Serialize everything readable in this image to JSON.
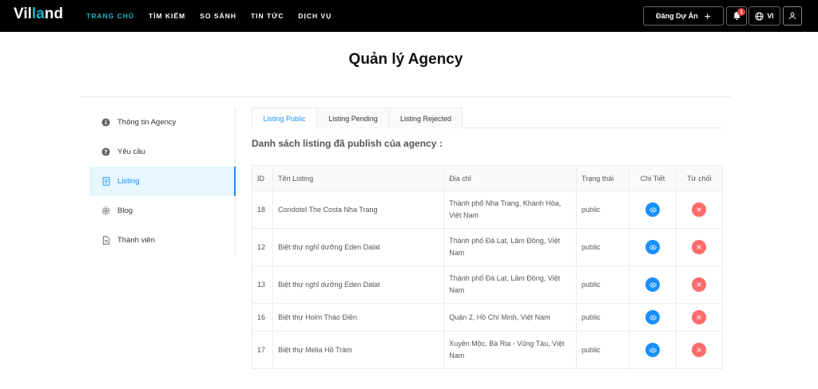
{
  "header": {
    "logo_prefix": "Vil",
    "logo_highlight": "la",
    "logo_suffix": "nd",
    "nav": [
      {
        "label": "TRANG CHỦ",
        "active": true
      },
      {
        "label": "TÌM KIẾM",
        "active": false
      },
      {
        "label": "SO SÁNH",
        "active": false
      },
      {
        "label": "TIN TỨC",
        "active": false
      },
      {
        "label": "DỊCH VỤ",
        "active": false
      }
    ],
    "post_label": "Đăng Dự Án",
    "notification_count": "1",
    "language": "Vi"
  },
  "page": {
    "title": "Quản lý Agency"
  },
  "sidebar": {
    "items": [
      {
        "label": "Thông tin Agency",
        "icon": "info-icon"
      },
      {
        "label": "Yêu cầu",
        "icon": "question-icon"
      },
      {
        "label": "Listing",
        "icon": "document-icon"
      },
      {
        "label": "Blog",
        "icon": "gear-icon"
      },
      {
        "label": "Thành viên",
        "icon": "file-icon"
      }
    ]
  },
  "tabs": [
    {
      "label": "Listing Public"
    },
    {
      "label": "Listing Pending"
    },
    {
      "label": "Listing Rejected"
    }
  ],
  "section_title": "Danh sách listing đã publish của agency :",
  "table": {
    "headers": {
      "id": "ID",
      "name": "Tên Listing",
      "address": "Địa chỉ",
      "status": "Trạng thái",
      "detail": "Chi Tiết",
      "reject": "Từ chối"
    },
    "rows": [
      {
        "id": "18",
        "name": "Condotel The Costa Nha Trang",
        "address": "Thành phố Nha Trang, Khánh Hòa, Việt Nam",
        "status": "public"
      },
      {
        "id": "12",
        "name": "Biệt thự nghỉ dưỡng Eden Dalat",
        "address": "Thành phố Đà Lạt, Lâm Đồng, Việt Nam",
        "status": "public"
      },
      {
        "id": "13",
        "name": "Biệt thự nghỉ dưỡng Eden Dalat",
        "address": "Thành phố Đà Lạt, Lâm Đồng, Việt Nam",
        "status": "public"
      },
      {
        "id": "16",
        "name": "Biệt thự Holm Tháo Điền",
        "address": "Quận 2, Hồ Chí Minh, Việt Nam",
        "status": "public"
      },
      {
        "id": "17",
        "name": "Biệt thự Melia Hồ Tràm",
        "address": "Xuyên Mộc, Bà Rịa - Vũng Tàu, Việt Nam",
        "status": "public"
      }
    ]
  },
  "colors": {
    "accent": "#1fb6c1",
    "primary": "#1890ff",
    "danger": "#ff6b6b"
  }
}
